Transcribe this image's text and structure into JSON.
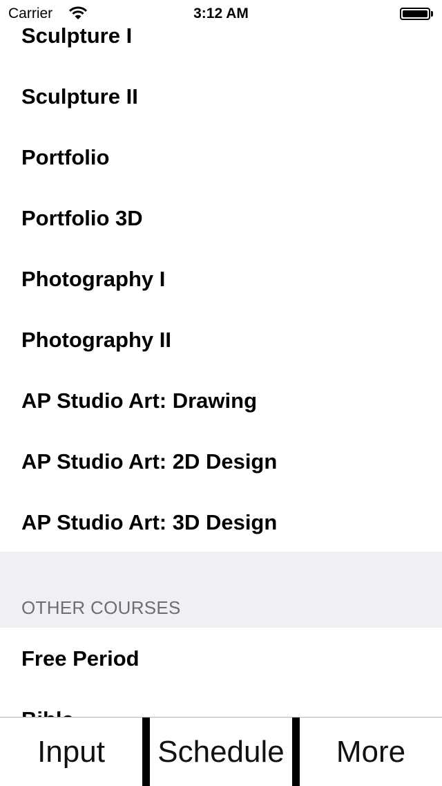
{
  "status_bar": {
    "carrier": "Carrier",
    "wifi_icon": "wifi-icon",
    "time": "3:12 AM",
    "battery_icon": "battery-icon"
  },
  "course_list": {
    "art_items": [
      "Sculpture I",
      "Sculpture II",
      "Portfolio",
      "Portfolio 3D",
      "Photography I",
      "Photography II",
      "AP Studio Art: Drawing",
      "AP Studio Art: 2D Design",
      "AP Studio Art: 3D Design"
    ],
    "other_header": "OTHER COURSES",
    "other_items": [
      "Free Period",
      "Bible"
    ]
  },
  "tab_bar": {
    "tabs": [
      "Input",
      "Schedule",
      "More"
    ]
  },
  "colors": {
    "section_background": "#efeff4",
    "section_text": "#6d6d72",
    "tab_separator": "#000000"
  }
}
